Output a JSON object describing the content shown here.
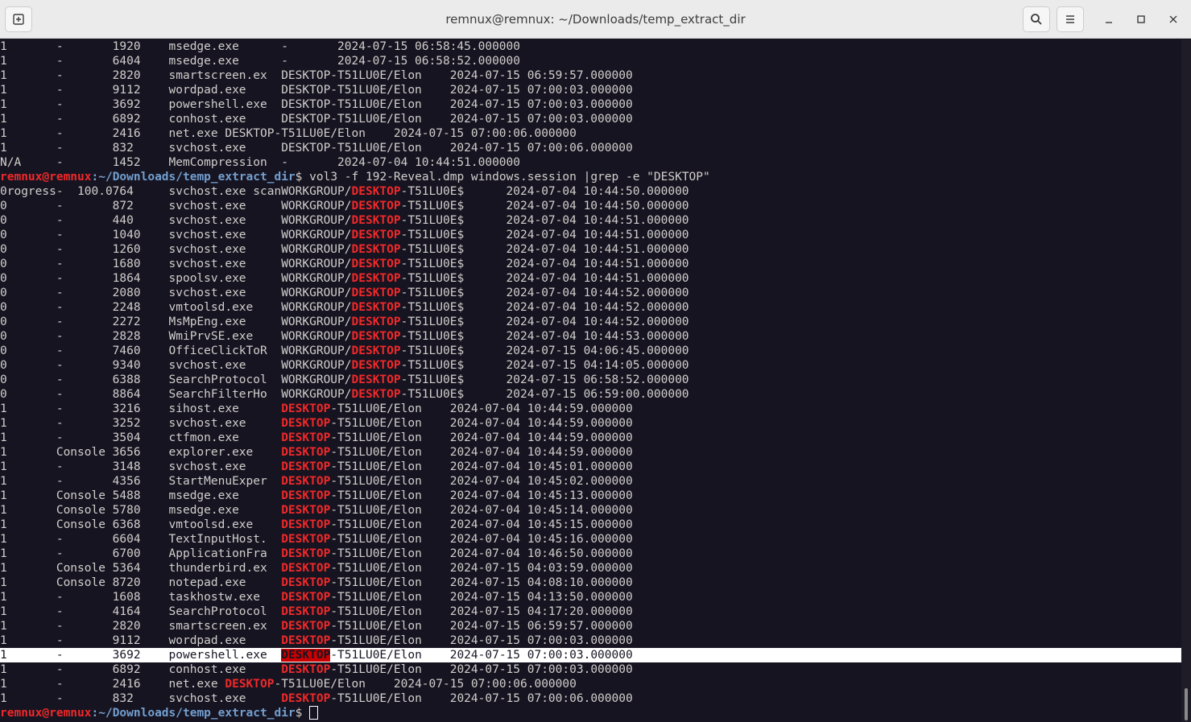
{
  "window": {
    "title": "remnux@remnux: ~/Downloads/temp_extract_dir",
    "icons": {
      "new_tab": "new-tab-icon",
      "search": "search-icon",
      "menu": "hamburger-menu-icon",
      "minimize": "minimize-icon",
      "maximize": "maximize-icon",
      "close": "close-icon"
    }
  },
  "terminal": {
    "prompt": {
      "user_host": "remnux@remnux",
      "path": ":~/Downloads/temp_extract_dir",
      "symbol": "$ "
    },
    "command": "vol3 -f 192-Reveal.dmp windows.session |grep -e \"DESKTOP\"",
    "highlight_term": "DESKTOP",
    "colors": {
      "background": "#171421",
      "text": "#d0cfcc",
      "highlight": "#ef2929",
      "prompt_user": "#ef2929",
      "prompt_path": "#729fcf"
    },
    "pre_lines": [
      "1       -       1920    msedge.exe      -       2024-07-15 06:58:45.000000",
      "1       -       6404    msedge.exe      -       2024-07-15 06:58:52.000000",
      "1       -       2820    smartscreen.ex  DESKTOP-T51LU0E/Elon    2024-07-15 06:59:57.000000",
      "1       -       9112    wordpad.exe     DESKTOP-T51LU0E/Elon    2024-07-15 07:00:03.000000",
      "1       -       3692    powershell.exe  DESKTOP-T51LU0E/Elon    2024-07-15 07:00:03.000000",
      "1       -       6892    conhost.exe     DESKTOP-T51LU0E/Elon    2024-07-15 07:00:03.000000",
      "1       -       2416    net.exe DESKTOP-T51LU0E/Elon    2024-07-15 07:00:06.000000",
      "1       -       832     svchost.exe     DESKTOP-T51LU0E/Elon    2024-07-15 07:00:06.000000",
      "N/A     -       1452    MemCompression  -       2024-07-04 10:44:51.000000"
    ],
    "output_lines": [
      "0rogress-  100.0764     svchost.exe scanWORKGROUP/DESKTOP-T51LU0E$      2024-07-04 10:44:50.000000",
      "0       -       872     svchost.exe     WORKGROUP/DESKTOP-T51LU0E$      2024-07-04 10:44:50.000000",
      "0       -       440     svchost.exe     WORKGROUP/DESKTOP-T51LU0E$      2024-07-04 10:44:51.000000",
      "0       -       1040    svchost.exe     WORKGROUP/DESKTOP-T51LU0E$      2024-07-04 10:44:51.000000",
      "0       -       1260    svchost.exe     WORKGROUP/DESKTOP-T51LU0E$      2024-07-04 10:44:51.000000",
      "0       -       1680    svchost.exe     WORKGROUP/DESKTOP-T51LU0E$      2024-07-04 10:44:51.000000",
      "0       -       1864    spoolsv.exe     WORKGROUP/DESKTOP-T51LU0E$      2024-07-04 10:44:51.000000",
      "0       -       2080    svchost.exe     WORKGROUP/DESKTOP-T51LU0E$      2024-07-04 10:44:52.000000",
      "0       -       2248    vmtoolsd.exe    WORKGROUP/DESKTOP-T51LU0E$      2024-07-04 10:44:52.000000",
      "0       -       2272    MsMpEng.exe     WORKGROUP/DESKTOP-T51LU0E$      2024-07-04 10:44:52.000000",
      "0       -       2828    WmiPrvSE.exe    WORKGROUP/DESKTOP-T51LU0E$      2024-07-04 10:44:53.000000",
      "0       -       7460    OfficeClickToR  WORKGROUP/DESKTOP-T51LU0E$      2024-07-15 04:06:45.000000",
      "0       -       9340    svchost.exe     WORKGROUP/DESKTOP-T51LU0E$      2024-07-15 04:14:05.000000",
      "0       -       6388    SearchProtocol  WORKGROUP/DESKTOP-T51LU0E$      2024-07-15 06:58:52.000000",
      "0       -       8864    SearchFilterHo  WORKGROUP/DESKTOP-T51LU0E$      2024-07-15 06:59:00.000000",
      "1       -       3216    sihost.exe      DESKTOP-T51LU0E/Elon    2024-07-04 10:44:59.000000",
      "1       -       3252    svchost.exe     DESKTOP-T51LU0E/Elon    2024-07-04 10:44:59.000000",
      "1       -       3504    ctfmon.exe      DESKTOP-T51LU0E/Elon    2024-07-04 10:44:59.000000",
      "1       Console 3656    explorer.exe    DESKTOP-T51LU0E/Elon    2024-07-04 10:44:59.000000",
      "1       -       3148    svchost.exe     DESKTOP-T51LU0E/Elon    2024-07-04 10:45:01.000000",
      "1       -       4356    StartMenuExper  DESKTOP-T51LU0E/Elon    2024-07-04 10:45:02.000000",
      "1       Console 5488    msedge.exe      DESKTOP-T51LU0E/Elon    2024-07-04 10:45:13.000000",
      "1       Console 5780    msedge.exe      DESKTOP-T51LU0E/Elon    2024-07-04 10:45:14.000000",
      "1       Console 6368    vmtoolsd.exe    DESKTOP-T51LU0E/Elon    2024-07-04 10:45:15.000000",
      "1       -       6604    TextInputHost.  DESKTOP-T51LU0E/Elon    2024-07-04 10:45:16.000000",
      "1       -       6700    ApplicationFra  DESKTOP-T51LU0E/Elon    2024-07-04 10:46:50.000000",
      "1       Console 5364    thunderbird.ex  DESKTOP-T51LU0E/Elon    2024-07-15 04:03:59.000000",
      "1       Console 8720    notepad.exe     DESKTOP-T51LU0E/Elon    2024-07-15 04:08:10.000000",
      "1       -       1608    taskhostw.exe   DESKTOP-T51LU0E/Elon    2024-07-15 04:13:50.000000",
      "1       -       4164    SearchProtocol  DESKTOP-T51LU0E/Elon    2024-07-15 04:17:20.000000",
      "1       -       2820    smartscreen.ex  DESKTOP-T51LU0E/Elon    2024-07-15 06:59:57.000000",
      "1       -       9112    wordpad.exe     DESKTOP-T51LU0E/Elon    2024-07-15 07:00:03.000000",
      "1       -       3692    powershell.exe  DESKTOP-T51LU0E/Elon    2024-07-15 07:00:03.000000",
      "1       -       6892    conhost.exe     DESKTOP-T51LU0E/Elon    2024-07-15 07:00:03.000000",
      "1       -       2416    net.exe DESKTOP-T51LU0E/Elon    2024-07-15 07:00:06.000000",
      "1       -       832     svchost.exe     DESKTOP-T51LU0E/Elon    2024-07-15 07:00:06.000000"
    ],
    "selected_output_index": 32
  }
}
